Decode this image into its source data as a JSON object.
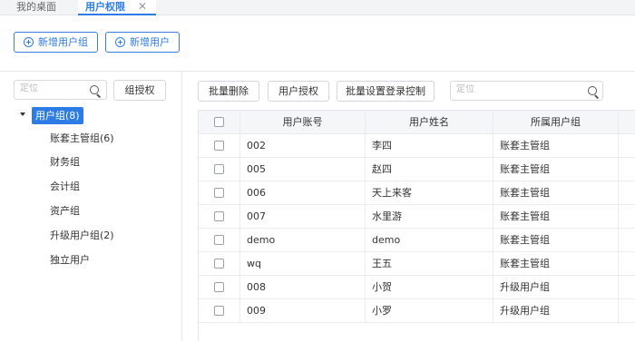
{
  "tabs": {
    "desktop": "我的桌面",
    "permissions": "用户权限",
    "close_glyph": "✕"
  },
  "toolbar": {
    "add_group": "新增用户组",
    "add_user": "新增用户"
  },
  "left": {
    "search_placeholder": "定位",
    "group_auth": "组授权",
    "tree": {
      "root": "用户组(8)",
      "children": [
        "账套主管组(6)",
        "财务组",
        "会计组",
        "资产组",
        "升级用户组(2)",
        "独立用户"
      ]
    }
  },
  "right": {
    "batch_delete": "批量删除",
    "user_auth": "用户授权",
    "login_control": "批量设置登录控制",
    "search_placeholder": "定位"
  },
  "table": {
    "headers": [
      "用户账号",
      "用户姓名",
      "所属用户组"
    ],
    "rows": [
      [
        "002",
        "李四",
        "账套主管组"
      ],
      [
        "005",
        "赵四",
        "账套主管组"
      ],
      [
        "006",
        "天上来客",
        "账套主管组"
      ],
      [
        "007",
        "水里游",
        "账套主管组"
      ],
      [
        "demo",
        "demo",
        "账套主管组"
      ],
      [
        "wq",
        "王五",
        "账套主管组"
      ],
      [
        "008",
        "小贺",
        "升级用户组"
      ],
      [
        "009",
        "小罗",
        "升级用户组"
      ]
    ]
  },
  "colors": {
    "accent": "#2d7be5",
    "header_bg": "#f5f6f8",
    "tab_bg": "#f3f4f6"
  }
}
